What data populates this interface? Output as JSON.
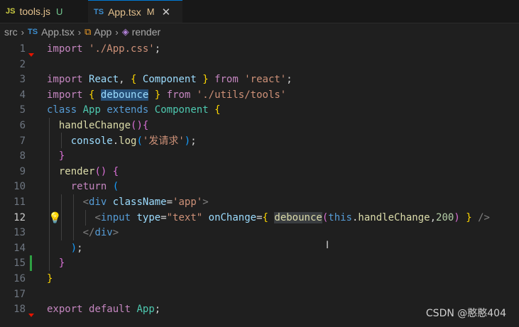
{
  "tabs": [
    {
      "lang": "JS",
      "name": "tools.js",
      "status": "U"
    },
    {
      "lang": "TS",
      "name": "App.tsx",
      "status": "M",
      "close": "✕"
    }
  ],
  "breadcrumb": {
    "folder": "src",
    "file_lang": "TS",
    "file": "App.tsx",
    "class": "App",
    "method": "render"
  },
  "lines": [
    "1",
    "2",
    "3",
    "4",
    "5",
    "6",
    "7",
    "8",
    "9",
    "10",
    "11",
    "12",
    "13",
    "14",
    "15",
    "16",
    "17",
    "18"
  ],
  "code": {
    "l1": [
      "import",
      "'./App.css'",
      ";"
    ],
    "l3": [
      "import",
      "React",
      ", ",
      "{",
      "Component",
      "}",
      "from",
      "'react'",
      ";"
    ],
    "l4": [
      "import",
      "{",
      "debounce",
      "}",
      "from",
      "'./utils/tools'"
    ],
    "l5": [
      "class",
      "App",
      "extends",
      "Component",
      "{"
    ],
    "l6": [
      "handleChange",
      "()",
      "{"
    ],
    "l7": [
      "console",
      ".",
      "log",
      "(",
      "'发请求'",
      ")",
      ";"
    ],
    "l8": [
      "}"
    ],
    "l9": [
      "render",
      "()",
      "{"
    ],
    "l10": [
      "return",
      "("
    ],
    "l11": [
      "<",
      "div",
      "className",
      "=",
      "'app'",
      ">"
    ],
    "l12": [
      "<",
      "input",
      "type",
      "=",
      "\"text\"",
      "onChange",
      "=",
      "{",
      "debounce",
      "(",
      "this",
      ".",
      "handleChange",
      ",",
      "200",
      ")",
      "}",
      "/>"
    ],
    "l13": [
      "</",
      "div",
      ">"
    ],
    "l14": [
      ")",
      ";"
    ],
    "l15": [
      "}"
    ],
    "l16": [
      "}"
    ],
    "l18": [
      "export",
      "default",
      "App",
      ";"
    ]
  },
  "watermark": "CSDN @憨憨404",
  "icons": {
    "bulb": "lightbulb-icon",
    "cursor": "text-cursor-icon"
  }
}
